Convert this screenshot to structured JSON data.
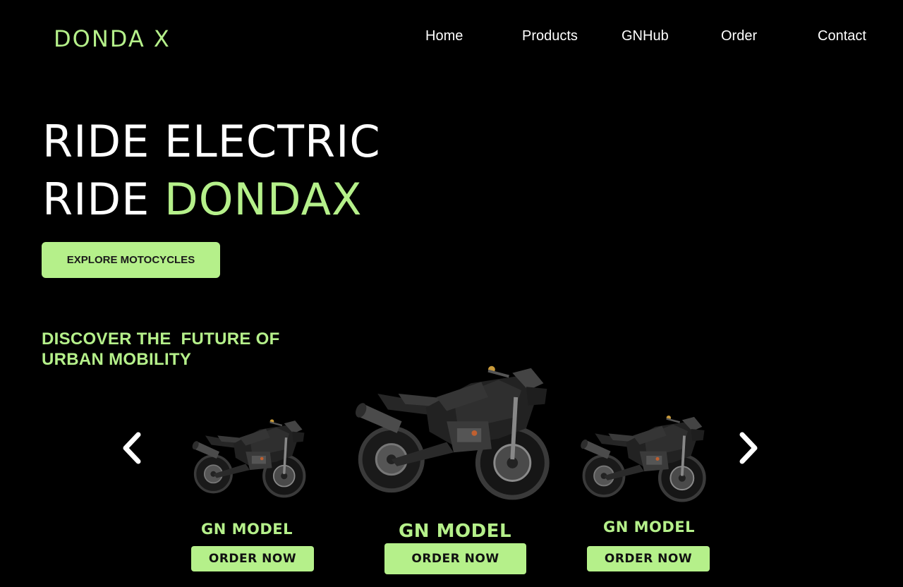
{
  "brand": {
    "logo": "DONDA X"
  },
  "nav": {
    "home": "Home",
    "products": "Products",
    "gnhub": "GNHub",
    "order": "Order",
    "contact": "Contact"
  },
  "hero": {
    "line1": "RIDE ELECTRIC",
    "line2_prefix": "RIDE ",
    "line2_accent": "DONDAX",
    "cta": "EXPLORE MOTOCYCLES"
  },
  "discover": {
    "line1": "DISCOVER THE  FUTURE OF",
    "line2": "URBAN MOBILITY"
  },
  "carousel": {
    "items": [
      {
        "model": "GN MODEL",
        "button": "ORDER NOW"
      },
      {
        "model": "GN MODEL",
        "button": "ORDER NOW"
      },
      {
        "model": "GN MODEL",
        "button": "ORDER NOW"
      }
    ],
    "prev_icon": "chevron-left-icon",
    "next_icon": "chevron-right-icon"
  },
  "colors": {
    "accent": "#b5f08a",
    "background": "#000000",
    "text": "#ffffff"
  }
}
